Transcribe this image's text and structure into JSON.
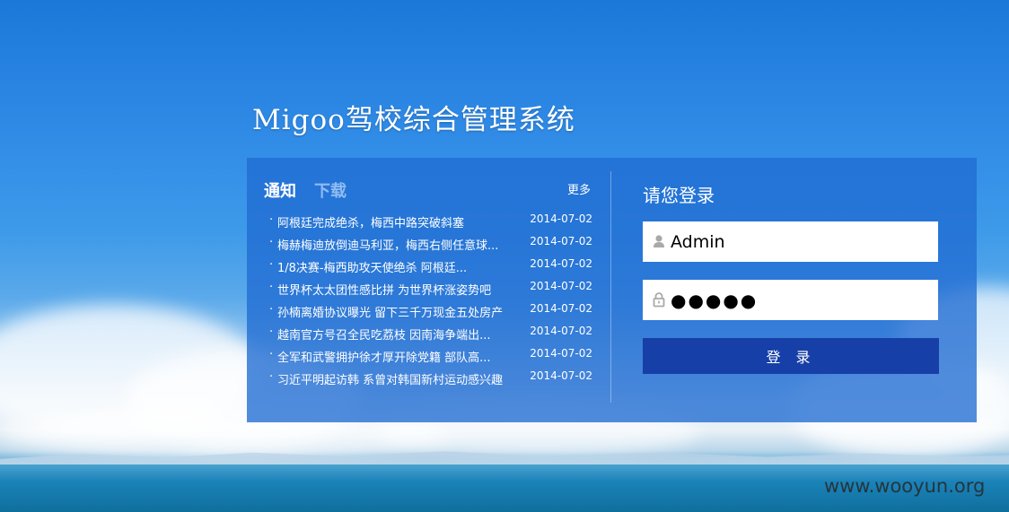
{
  "app": {
    "title": "Migoo驾校综合管理系统"
  },
  "news_panel": {
    "tabs": [
      {
        "label": "通知",
        "active": true
      },
      {
        "label": "下载",
        "active": false
      }
    ],
    "more_label": "更多",
    "items": [
      {
        "title": "阿根廷完成绝杀，梅西中路突破斜塞",
        "date": "2014-07-02"
      },
      {
        "title": "梅赫梅迪放倒迪马利亚，梅西右侧任意球...",
        "date": "2014-07-02"
      },
      {
        "title": "1/8决赛-梅西助攻天使绝杀 阿根廷...",
        "date": "2014-07-02"
      },
      {
        "title": "世界杯太太团性感比拼 为世界杯涨姿势吧",
        "date": "2014-07-02"
      },
      {
        "title": "孙楠离婚协议曝光 留下三千万现金五处房产",
        "date": "2014-07-02"
      },
      {
        "title": "越南官方号召全民吃荔枝 因南海争端出...",
        "date": "2014-07-02"
      },
      {
        "title": "全军和武警拥护徐才厚开除党籍 部队高...",
        "date": "2014-07-02"
      },
      {
        "title": "习近平明起访韩 系曾对韩国新村运动感兴趣",
        "date": "2014-07-02"
      }
    ]
  },
  "login": {
    "title": "请您登录",
    "username_value": "Admin",
    "password_value": "●●●●●",
    "submit_label": "登 录"
  },
  "watermark": "www.wooyun.org",
  "colors": {
    "panel": "#206cd2",
    "button": "#173fa8",
    "tab_inactive": "#8fbdf2"
  }
}
